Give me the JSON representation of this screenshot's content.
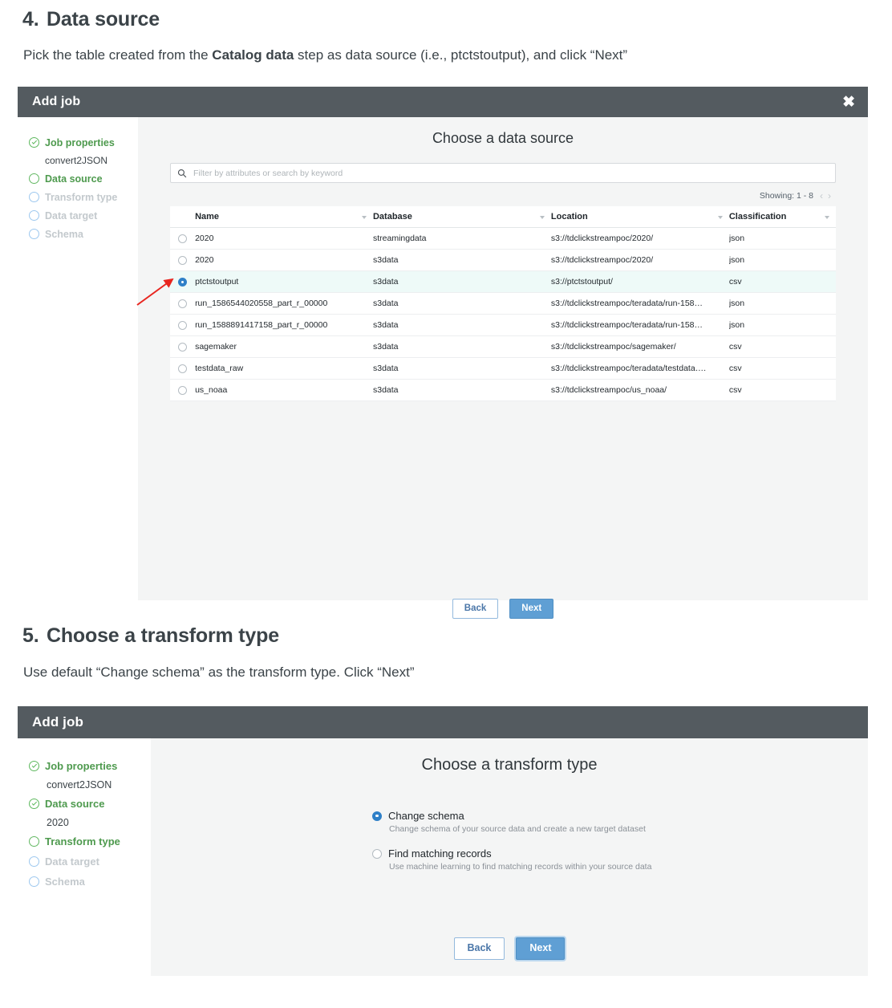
{
  "sections": [
    {
      "number": "4.",
      "heading": "Data source",
      "body_pre": "Pick the table created from the ",
      "body_bold": "Catalog data",
      "body_post": " step as data source (i.e., ptctstoutput), and click “Next”"
    },
    {
      "number": "5.",
      "heading": "Choose a transform type",
      "body_pre": "Use default “Change schema” as the transform type. Click “Next”",
      "body_bold": "",
      "body_post": ""
    }
  ],
  "dialog1": {
    "title": "Add job",
    "close_icon": "close-icon",
    "sidebar": [
      {
        "label": "Job properties",
        "state": "done"
      },
      {
        "label": "convert2JSON",
        "state": "sub"
      },
      {
        "label": "Data source",
        "state": "active"
      },
      {
        "label": "Transform type",
        "state": "todo"
      },
      {
        "label": "Data target",
        "state": "todo"
      },
      {
        "label": "Schema",
        "state": "todo"
      }
    ],
    "panel_title": "Choose a data source",
    "search": {
      "icon": "search-icon",
      "placeholder": "Filter by attributes or search by keyword",
      "value": ""
    },
    "showing": "Showing: 1 - 8",
    "pager_prev": "‹",
    "pager_next": "›",
    "columns": [
      "Name",
      "Database",
      "Location",
      "Classification"
    ],
    "rows": [
      {
        "selected": false,
        "name": "2020",
        "database": "streamingdata",
        "location": "s3://tdclickstreampoc/2020/",
        "classification": "json"
      },
      {
        "selected": false,
        "name": "2020",
        "database": "s3data",
        "location": "s3://tdclickstreampoc/2020/",
        "classification": "json"
      },
      {
        "selected": true,
        "name": "ptctstoutput",
        "database": "s3data",
        "location": "s3://ptctstoutput/",
        "classification": "csv"
      },
      {
        "selected": false,
        "name": "run_1586544020558_part_r_00000",
        "database": "s3data",
        "location": "s3://tdclickstreampoc/teradata/run-158…",
        "classification": "json"
      },
      {
        "selected": false,
        "name": "run_1588891417158_part_r_00000",
        "database": "s3data",
        "location": "s3://tdclickstreampoc/teradata/run-158…",
        "classification": "json"
      },
      {
        "selected": false,
        "name": "sagemaker",
        "database": "s3data",
        "location": "s3://tdclickstreampoc/sagemaker/",
        "classification": "csv"
      },
      {
        "selected": false,
        "name": "testdata_raw",
        "database": "s3data",
        "location": "s3://tdclickstreampoc/teradata/testdata….",
        "classification": "csv"
      },
      {
        "selected": false,
        "name": "us_noaa",
        "database": "s3data",
        "location": "s3://tdclickstreampoc/us_noaa/",
        "classification": "csv"
      }
    ],
    "buttons": {
      "back": "Back",
      "next": "Next"
    },
    "annotation": {
      "type": "arrow",
      "color": "#e8251f"
    }
  },
  "dialog2": {
    "title": "Add job",
    "sidebar": [
      {
        "label": "Job properties",
        "state": "done"
      },
      {
        "label": "convert2JSON",
        "state": "sub"
      },
      {
        "label": "Data source",
        "state": "done"
      },
      {
        "label": "2020",
        "state": "sub"
      },
      {
        "label": "Transform type",
        "state": "active"
      },
      {
        "label": "Data target",
        "state": "todo"
      },
      {
        "label": "Schema",
        "state": "todo"
      }
    ],
    "panel_title": "Choose a transform type",
    "options": [
      {
        "selected": true,
        "label": "Change schema",
        "description": "Change schema of your source data and create a new target dataset"
      },
      {
        "selected": false,
        "label": "Find matching records",
        "description": "Use machine learning to find matching records within your source data"
      }
    ],
    "buttons": {
      "back": "Back",
      "next": "Next"
    }
  },
  "colors": {
    "header_bar": "#545b60",
    "accent_blue": "#5f9fd4",
    "step_green": "#5eb85e",
    "selected_row": "#eefaf8",
    "annotation_red": "#e8251f"
  }
}
